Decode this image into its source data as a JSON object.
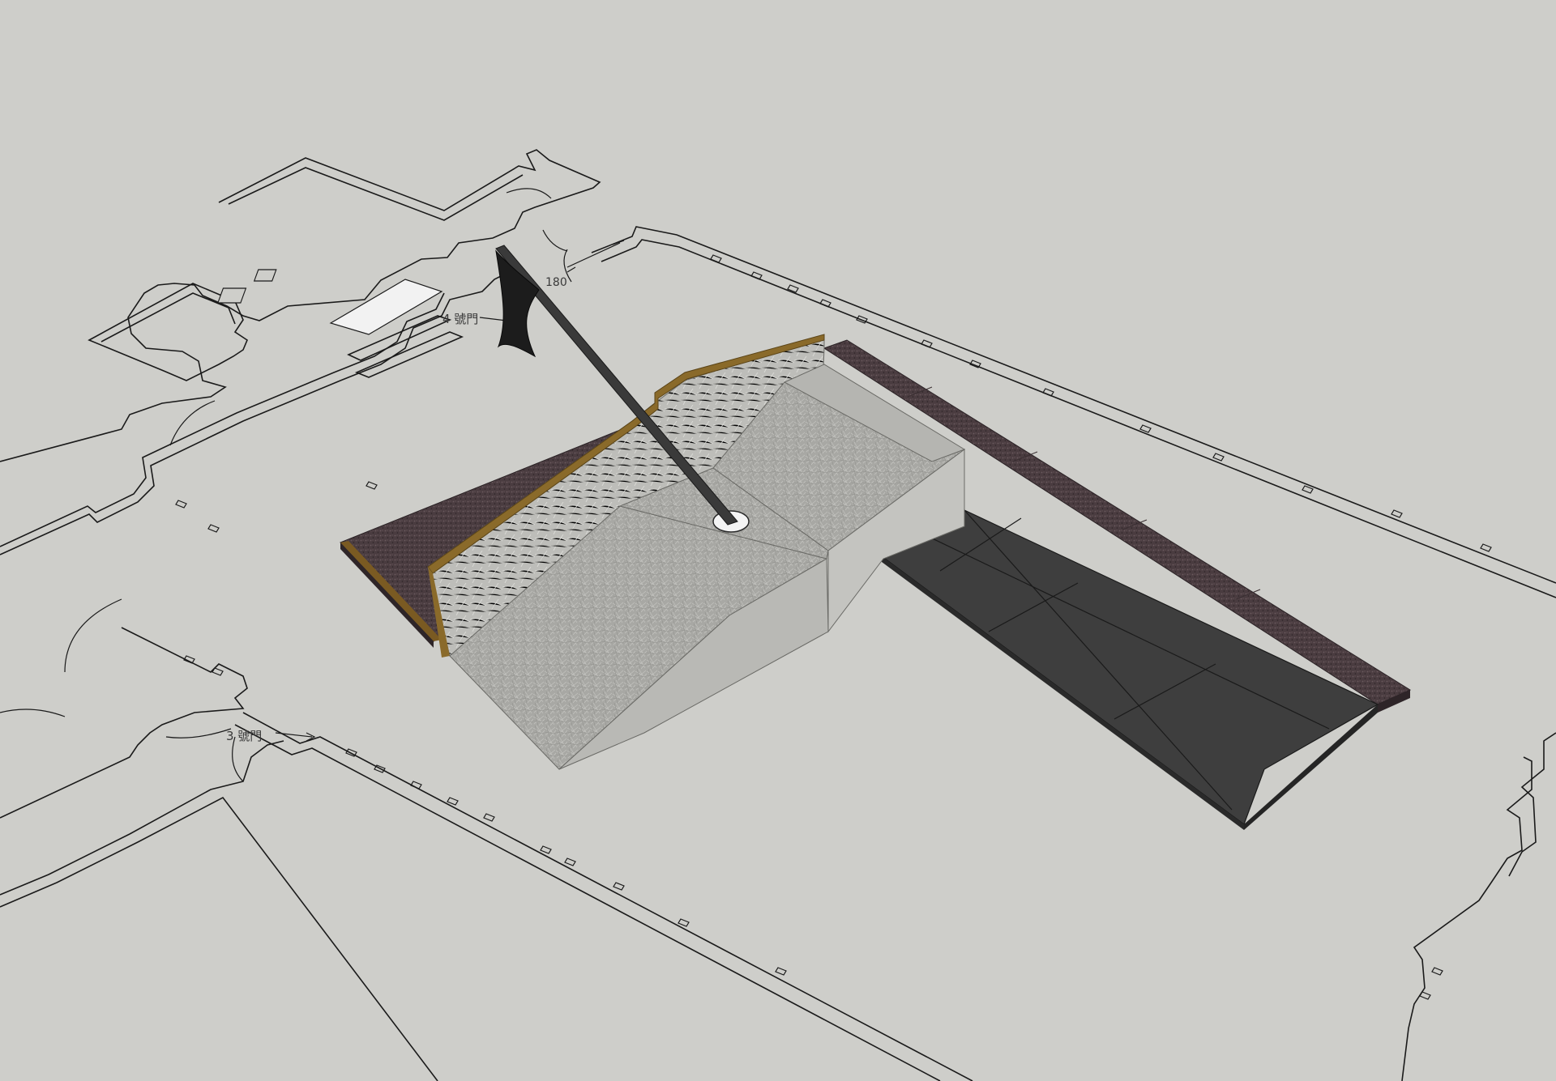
{
  "labels": {
    "door_4": "4 號門",
    "door_3": "3 號門",
    "dimension": "180"
  },
  "colors": {
    "background": "#cececa",
    "plan_line": "#1a1a1a",
    "carpet": "#4a3c40",
    "concrete": "#a9a9a5",
    "dark_tile": "#3e3e3e",
    "wood_edge": "#8a6a2a",
    "white_slab": "#f2f2f2"
  }
}
